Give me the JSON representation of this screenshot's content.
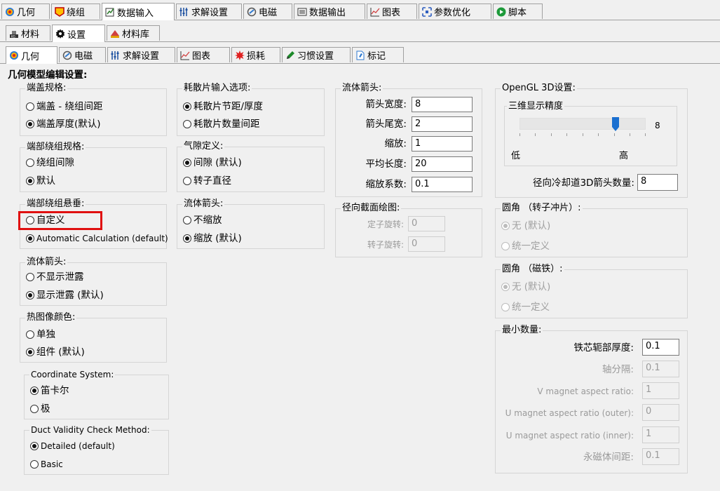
{
  "tabs_row1": [
    "几何",
    "绕组",
    "数据输入",
    "求解设置",
    "电磁",
    "数据输出",
    "图表",
    "参数优化",
    "脚本"
  ],
  "tabs_row2": [
    "材料",
    "设置",
    "材料库"
  ],
  "tabs_row3": [
    "几何",
    "电磁",
    "求解设置",
    "图表",
    "损耗",
    "习惯设置",
    "标记"
  ],
  "heading": "几何模型编辑设置:",
  "col1": {
    "end_cap": {
      "title": "端盖规格:",
      "options": [
        "端盖 - 绕组间距",
        "端盖厚度(默认)"
      ]
    },
    "end_winding": {
      "title": "端部绕组规格:",
      "options": [
        "绕组间隙",
        "默认"
      ]
    },
    "end_overhang": {
      "title": "端部绕组悬垂:",
      "options": [
        "自定义",
        "Automatic Calculation (default)"
      ]
    },
    "flow_arrow": {
      "title": "流体箭头:",
      "options": [
        "不显示泄露",
        "显示泄露 (默认)"
      ]
    },
    "thermal_color": {
      "title": "热图像颜色:",
      "options": [
        "单独",
        "组件 (默认)"
      ]
    },
    "coord": {
      "title": "Coordinate System:",
      "options": [
        "笛卡尔",
        "极"
      ]
    },
    "duct": {
      "title": "Duct Validity Check Method:",
      "options": [
        "Detailed (default)",
        "Basic"
      ]
    }
  },
  "col2": {
    "fin": {
      "title": "耗散片输入选项:",
      "options": [
        "耗散片节距/厚度",
        "耗散片数量间距"
      ]
    },
    "gap": {
      "title": "气隙定义:",
      "options": [
        "间隙 (默认)",
        "转子直径"
      ]
    },
    "flow": {
      "title": "流体箭头:",
      "options": [
        "不缩放",
        "缩放 (默认)"
      ]
    }
  },
  "col3": {
    "arrow": {
      "title": "流体箭头:",
      "fields": [
        {
          "label": "箭头宽度:",
          "value": "8"
        },
        {
          "label": "箭头尾宽:",
          "value": "2"
        },
        {
          "label": "缩放:",
          "value": "1"
        },
        {
          "label": "平均长度:",
          "value": "20"
        },
        {
          "label": "缩放系数:",
          "value": "0.1"
        }
      ]
    },
    "radial": {
      "title": "径向截面绘图:",
      "fields": [
        {
          "label": "定子旋转:",
          "value": "0"
        },
        {
          "label": "转子旋转:",
          "value": "0"
        }
      ]
    }
  },
  "col4": {
    "opengl": {
      "title": "OpenGL 3D设置:",
      "sub_title": "三维显示精度",
      "slider_value": "8",
      "slider_fraction": 0.75,
      "low": "低",
      "high": "高",
      "arrow_label": "径向冷却道3D箭头数量:",
      "arrow_value": "8"
    },
    "fillet_rotor": {
      "title": "圆角 （转子冲片）:",
      "options": [
        "无 (默认)",
        "统一定义"
      ]
    },
    "fillet_magnet": {
      "title": "圆角 （磁铁）:",
      "options": [
        "无 (默认)",
        "统一定义"
      ]
    },
    "min": {
      "title": "最小数量:",
      "fields": [
        {
          "label": "铁芯轭部厚度:",
          "value": "0.1"
        },
        {
          "label": "轴分隔:",
          "value": "0.1"
        },
        {
          "label": "V magnet aspect ratio:",
          "value": "1"
        },
        {
          "label": "U magnet aspect ratio (outer):",
          "value": "0"
        },
        {
          "label": "U magnet aspect ratio (inner):",
          "value": "1"
        },
        {
          "label": "永磁体间距:",
          "value": "0.1"
        }
      ]
    }
  },
  "colors": {
    "highlight": "#e01010",
    "slider_thumb": "#1a6fd0"
  }
}
